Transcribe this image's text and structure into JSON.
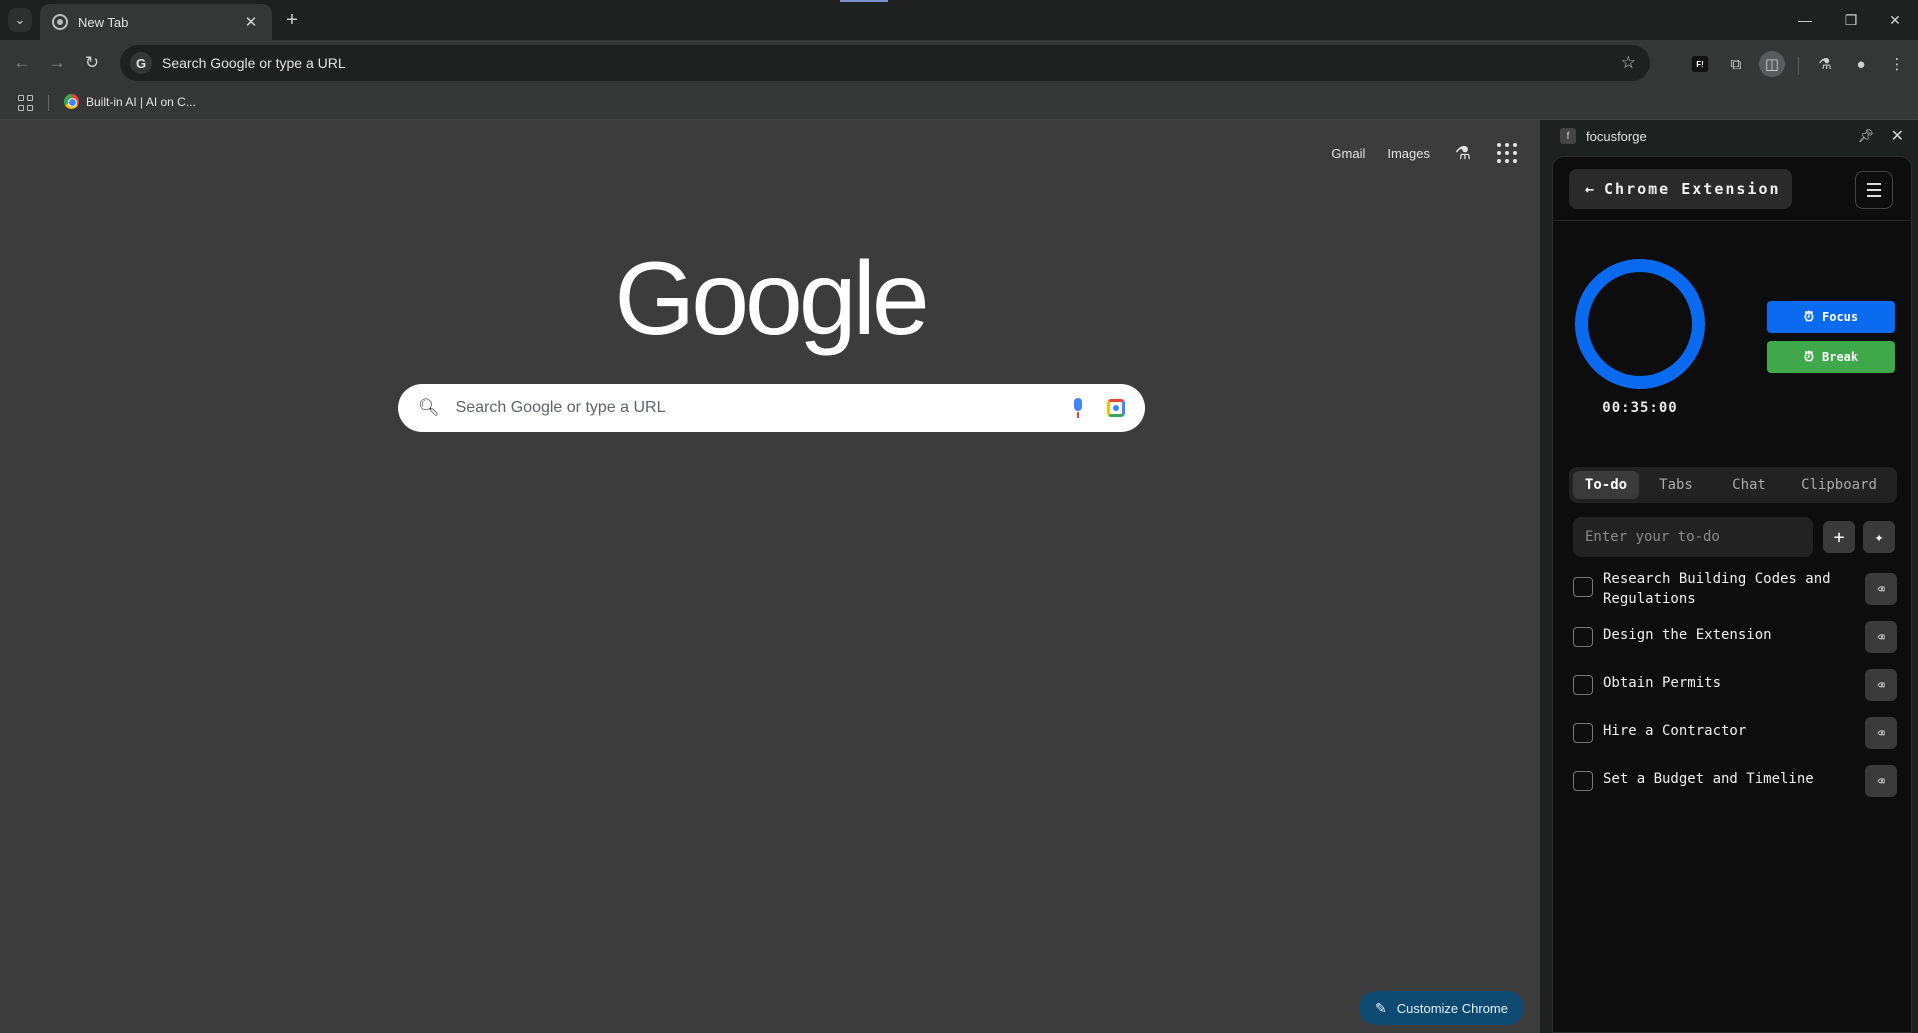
{
  "browser": {
    "tab_title": "New Tab",
    "omnibox_placeholder": "Search Google or type a URL",
    "bookmark_label": "Built-in AI  |  AI on C..."
  },
  "ntp": {
    "gmail": "Gmail",
    "images": "Images",
    "logo": "Google",
    "search_placeholder": "Search Google or type a URL",
    "customize": "Customize Chrome"
  },
  "side_panel": {
    "ext_icon_letter": "f",
    "ext_name": "focusforge",
    "toolbar_ext_badge": "F!"
  },
  "extension": {
    "header_title": "Chrome Extension",
    "timer": "00:35:00",
    "focus_label": "Focus",
    "break_label": "Break",
    "tabs": [
      "To-do",
      "Tabs",
      "Chat",
      "Clipboard"
    ],
    "active_tab": "To-do",
    "todo_placeholder": "Enter your to-do",
    "todos": [
      "Research Building Codes and Regulations",
      "Design the Extension",
      "Obtain Permits",
      "Hire a Contractor",
      "Set a Budget and Timeline"
    ],
    "colors": {
      "focus": "#0b6bf0",
      "break": "#3fa84a",
      "ring": "#0b6bf0"
    }
  }
}
